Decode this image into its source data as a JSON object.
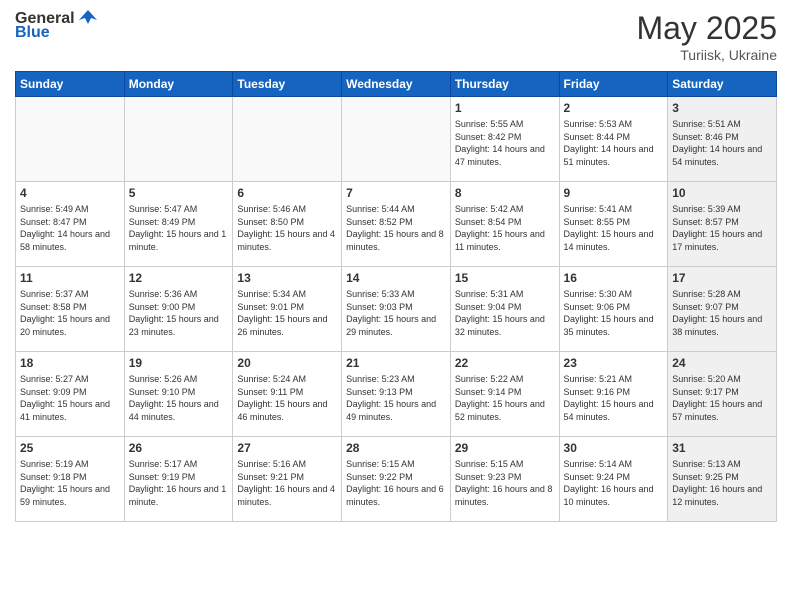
{
  "logo": {
    "general": "General",
    "blue": "Blue"
  },
  "header": {
    "month_year": "May 2025",
    "location": "Turiisk, Ukraine"
  },
  "days_of_week": [
    "Sunday",
    "Monday",
    "Tuesday",
    "Wednesday",
    "Thursday",
    "Friday",
    "Saturday"
  ],
  "weeks": [
    [
      {
        "day": "",
        "info": ""
      },
      {
        "day": "",
        "info": ""
      },
      {
        "day": "",
        "info": ""
      },
      {
        "day": "",
        "info": ""
      },
      {
        "day": "1",
        "info": "Sunrise: 5:55 AM\nSunset: 8:42 PM\nDaylight: 14 hours and 47 minutes."
      },
      {
        "day": "2",
        "info": "Sunrise: 5:53 AM\nSunset: 8:44 PM\nDaylight: 14 hours and 51 minutes."
      },
      {
        "day": "3",
        "info": "Sunrise: 5:51 AM\nSunset: 8:46 PM\nDaylight: 14 hours and 54 minutes."
      }
    ],
    [
      {
        "day": "4",
        "info": "Sunrise: 5:49 AM\nSunset: 8:47 PM\nDaylight: 14 hours and 58 minutes."
      },
      {
        "day": "5",
        "info": "Sunrise: 5:47 AM\nSunset: 8:49 PM\nDaylight: 15 hours and 1 minute."
      },
      {
        "day": "6",
        "info": "Sunrise: 5:46 AM\nSunset: 8:50 PM\nDaylight: 15 hours and 4 minutes."
      },
      {
        "day": "7",
        "info": "Sunrise: 5:44 AM\nSunset: 8:52 PM\nDaylight: 15 hours and 8 minutes."
      },
      {
        "day": "8",
        "info": "Sunrise: 5:42 AM\nSunset: 8:54 PM\nDaylight: 15 hours and 11 minutes."
      },
      {
        "day": "9",
        "info": "Sunrise: 5:41 AM\nSunset: 8:55 PM\nDaylight: 15 hours and 14 minutes."
      },
      {
        "day": "10",
        "info": "Sunrise: 5:39 AM\nSunset: 8:57 PM\nDaylight: 15 hours and 17 minutes."
      }
    ],
    [
      {
        "day": "11",
        "info": "Sunrise: 5:37 AM\nSunset: 8:58 PM\nDaylight: 15 hours and 20 minutes."
      },
      {
        "day": "12",
        "info": "Sunrise: 5:36 AM\nSunset: 9:00 PM\nDaylight: 15 hours and 23 minutes."
      },
      {
        "day": "13",
        "info": "Sunrise: 5:34 AM\nSunset: 9:01 PM\nDaylight: 15 hours and 26 minutes."
      },
      {
        "day": "14",
        "info": "Sunrise: 5:33 AM\nSunset: 9:03 PM\nDaylight: 15 hours and 29 minutes."
      },
      {
        "day": "15",
        "info": "Sunrise: 5:31 AM\nSunset: 9:04 PM\nDaylight: 15 hours and 32 minutes."
      },
      {
        "day": "16",
        "info": "Sunrise: 5:30 AM\nSunset: 9:06 PM\nDaylight: 15 hours and 35 minutes."
      },
      {
        "day": "17",
        "info": "Sunrise: 5:28 AM\nSunset: 9:07 PM\nDaylight: 15 hours and 38 minutes."
      }
    ],
    [
      {
        "day": "18",
        "info": "Sunrise: 5:27 AM\nSunset: 9:09 PM\nDaylight: 15 hours and 41 minutes."
      },
      {
        "day": "19",
        "info": "Sunrise: 5:26 AM\nSunset: 9:10 PM\nDaylight: 15 hours and 44 minutes."
      },
      {
        "day": "20",
        "info": "Sunrise: 5:24 AM\nSunset: 9:11 PM\nDaylight: 15 hours and 46 minutes."
      },
      {
        "day": "21",
        "info": "Sunrise: 5:23 AM\nSunset: 9:13 PM\nDaylight: 15 hours and 49 minutes."
      },
      {
        "day": "22",
        "info": "Sunrise: 5:22 AM\nSunset: 9:14 PM\nDaylight: 15 hours and 52 minutes."
      },
      {
        "day": "23",
        "info": "Sunrise: 5:21 AM\nSunset: 9:16 PM\nDaylight: 15 hours and 54 minutes."
      },
      {
        "day": "24",
        "info": "Sunrise: 5:20 AM\nSunset: 9:17 PM\nDaylight: 15 hours and 57 minutes."
      }
    ],
    [
      {
        "day": "25",
        "info": "Sunrise: 5:19 AM\nSunset: 9:18 PM\nDaylight: 15 hours and 59 minutes."
      },
      {
        "day": "26",
        "info": "Sunrise: 5:17 AM\nSunset: 9:19 PM\nDaylight: 16 hours and 1 minute."
      },
      {
        "day": "27",
        "info": "Sunrise: 5:16 AM\nSunset: 9:21 PM\nDaylight: 16 hours and 4 minutes."
      },
      {
        "day": "28",
        "info": "Sunrise: 5:15 AM\nSunset: 9:22 PM\nDaylight: 16 hours and 6 minutes."
      },
      {
        "day": "29",
        "info": "Sunrise: 5:15 AM\nSunset: 9:23 PM\nDaylight: 16 hours and 8 minutes."
      },
      {
        "day": "30",
        "info": "Sunrise: 5:14 AM\nSunset: 9:24 PM\nDaylight: 16 hours and 10 minutes."
      },
      {
        "day": "31",
        "info": "Sunrise: 5:13 AM\nSunset: 9:25 PM\nDaylight: 16 hours and 12 minutes."
      }
    ]
  ]
}
